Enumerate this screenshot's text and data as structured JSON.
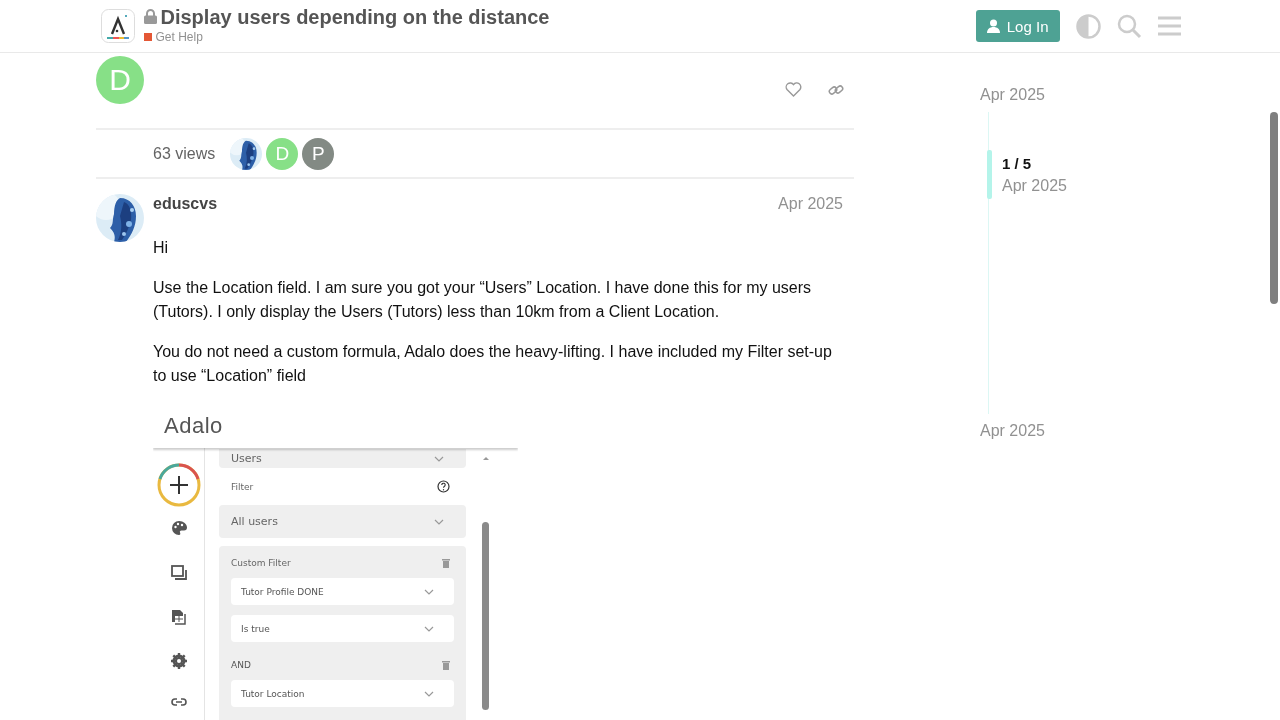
{
  "header": {
    "title": "Display users depending on the distance",
    "locked": true,
    "category": {
      "name": "Get Help",
      "color": "#e45735"
    },
    "login_button": "Log In"
  },
  "previous_post": {
    "avatar": {
      "kind": "letter",
      "letter": "D",
      "color": "#87e087"
    }
  },
  "topic_map": {
    "views": "63 views",
    "participants": [
      {
        "kind": "picture"
      },
      {
        "kind": "letter",
        "letter": "D",
        "color": "#87e087"
      },
      {
        "kind": "letter",
        "letter": "P",
        "color": "#838a84"
      }
    ]
  },
  "post": {
    "username": "eduscvs",
    "date": "Apr 2025",
    "avatar": {
      "kind": "picture"
    },
    "paragraphs": [
      "Hi",
      "Use the Location field. I am sure you got your “Users” Location. I have done this for my users (Tutors). I only display the Users (Tutors) less than 10km from a Client Location.",
      "You do not need a custom formula, Adalo does the heavy-lifting. I have included my Filter set-up to use “Location” field"
    ],
    "screenshot": {
      "logo": "Adalo",
      "collection": "Users",
      "filter_label": "Filter",
      "filter_value": "All users",
      "custom_filter": {
        "title": "Custom Filter",
        "rows": [
          {
            "kind": "select",
            "value": "Tutor Profile DONE"
          },
          {
            "kind": "select",
            "value": "Is true"
          },
          {
            "kind": "joiner",
            "label": "AND"
          },
          {
            "kind": "select",
            "value": "Tutor Location"
          }
        ]
      }
    }
  },
  "timeline": {
    "start": "Apr 2025",
    "position": "1 / 5",
    "position_date": "Apr 2025",
    "end": "Apr 2025"
  }
}
